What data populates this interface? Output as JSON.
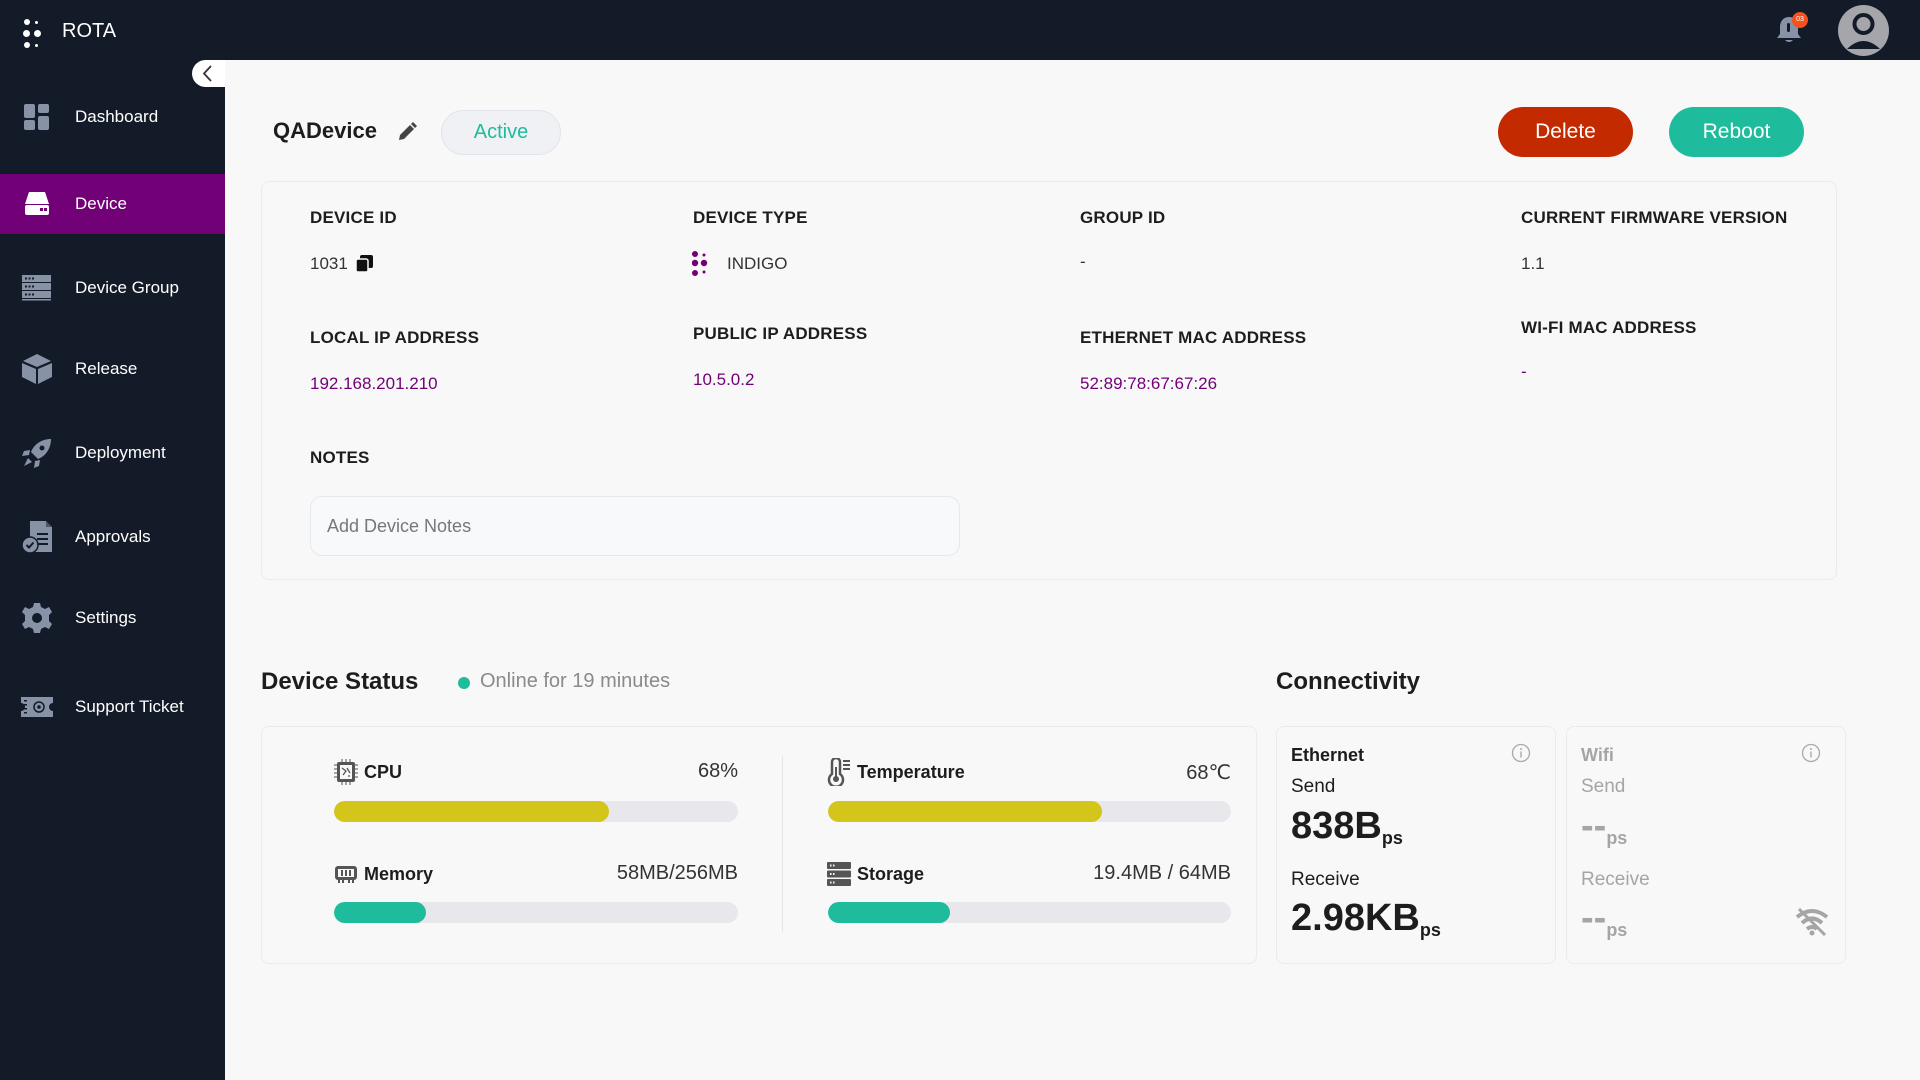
{
  "app": {
    "brand": "ROTA",
    "notifications_count": "03"
  },
  "sidebar": {
    "items": [
      {
        "label": "Dashboard",
        "icon": "dashboard-icon",
        "active": false
      },
      {
        "label": "Device",
        "icon": "device-icon",
        "active": true
      },
      {
        "label": "Device Group",
        "icon": "device-group-icon",
        "active": false
      },
      {
        "label": "Release",
        "icon": "box-icon",
        "active": false
      },
      {
        "label": "Deployment",
        "icon": "rocket-icon",
        "active": false
      },
      {
        "label": "Approvals",
        "icon": "document-check-icon",
        "active": false
      },
      {
        "label": "Settings",
        "icon": "gear-icon",
        "active": false
      },
      {
        "label": "Support Ticket",
        "icon": "ticket-icon",
        "active": false
      }
    ]
  },
  "device": {
    "name": "QADevice",
    "status": "Active",
    "actions": {
      "delete": "Delete",
      "reboot": "Reboot"
    },
    "fields": {
      "device_id": {
        "label": "DEVICE ID",
        "value": "1031"
      },
      "device_type": {
        "label": "DEVICE TYPE",
        "value": "INDIGO"
      },
      "group_id": {
        "label": "GROUP ID",
        "value": "-"
      },
      "firmware": {
        "label": "CURRENT FIRMWARE VERSION",
        "value": "1.1"
      },
      "local_ip": {
        "label": "LOCAL IP ADDRESS",
        "value": "192.168.201.210"
      },
      "public_ip": {
        "label": "PUBLIC IP ADDRESS",
        "value": "10.5.0.2"
      },
      "eth_mac": {
        "label": "ETHERNET MAC ADDRESS",
        "value": "52:89:78:67:67:26"
      },
      "wifi_mac": {
        "label": "WI-FI MAC ADDRESS",
        "value": "-"
      }
    },
    "notes": {
      "label": "NOTES",
      "placeholder": "Add Device Notes",
      "value": ""
    }
  },
  "device_status": {
    "title": "Device Status",
    "online_text": "Online for 19 minutes",
    "metrics": {
      "cpu": {
        "label": "CPU",
        "value": "68%",
        "fraction": 0.68,
        "color": "#d4c51a"
      },
      "memory": {
        "label": "Memory",
        "value": "58MB/256MB",
        "fraction": 0.2266,
        "color": "#1ebc9c"
      },
      "temperature": {
        "label": "Temperature",
        "value": "68℃",
        "fraction": 0.68,
        "color": "#d4c51a"
      },
      "storage": {
        "label": "Storage",
        "value": "19.4MB / 64MB",
        "fraction": 0.303,
        "color": "#1ebc9c"
      }
    }
  },
  "connectivity": {
    "title": "Connectivity",
    "ethernet": {
      "title": "Ethernet",
      "send_label": "Send",
      "send_value": "838B",
      "send_unit": "ps",
      "receive_label": "Receive",
      "receive_value": "2.98KB",
      "receive_unit": "ps"
    },
    "wifi": {
      "title": "Wifi",
      "send_label": "Send",
      "send_value": "--",
      "send_unit": "ps",
      "receive_label": "Receive",
      "receive_value": "--",
      "receive_unit": "ps"
    }
  }
}
